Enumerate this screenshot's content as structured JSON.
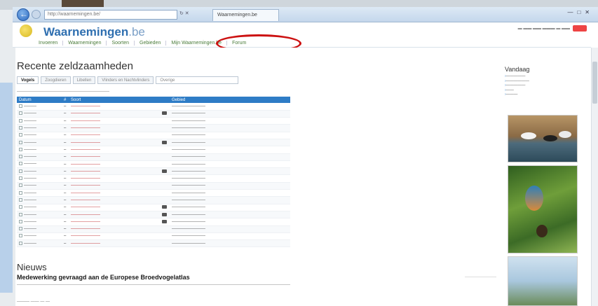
{
  "browser": {
    "address": "http://waarnemingen.be/",
    "tab_title": "Waarnemingen.be"
  },
  "site": {
    "logo": "Waarnemingen",
    "logo_suffix": ".be"
  },
  "main_nav": [
    {
      "label": "Invoeren"
    },
    {
      "label": "Waarnemingen"
    },
    {
      "label": "Soorten"
    },
    {
      "label": "Gebieden"
    },
    {
      "label": "Mijn Waarnemingen.be"
    },
    {
      "label": "Forum"
    }
  ],
  "page": {
    "title": "Recente zeldzaamheden",
    "filter_tabs": [
      "Vogels",
      "Zoogdieren",
      "Libellen",
      "Vlinders en Nachtvlinders",
      "Overige"
    ],
    "table_headers": [
      "Datum",
      "#",
      "Soort",
      "Gebied"
    ]
  },
  "news": {
    "title": "Nieuws",
    "headline": "Medewerking gevraagd aan de Europese Broedvogelatlas"
  },
  "sidebar": {
    "title": "Vandaag"
  },
  "colors": {
    "brand_blue": "#2f6fb0",
    "nav_green": "#4a7c3a",
    "table_header": "#2e7cc6",
    "rare_red": "#c0272d",
    "highlight_circle": "#cc1111"
  }
}
